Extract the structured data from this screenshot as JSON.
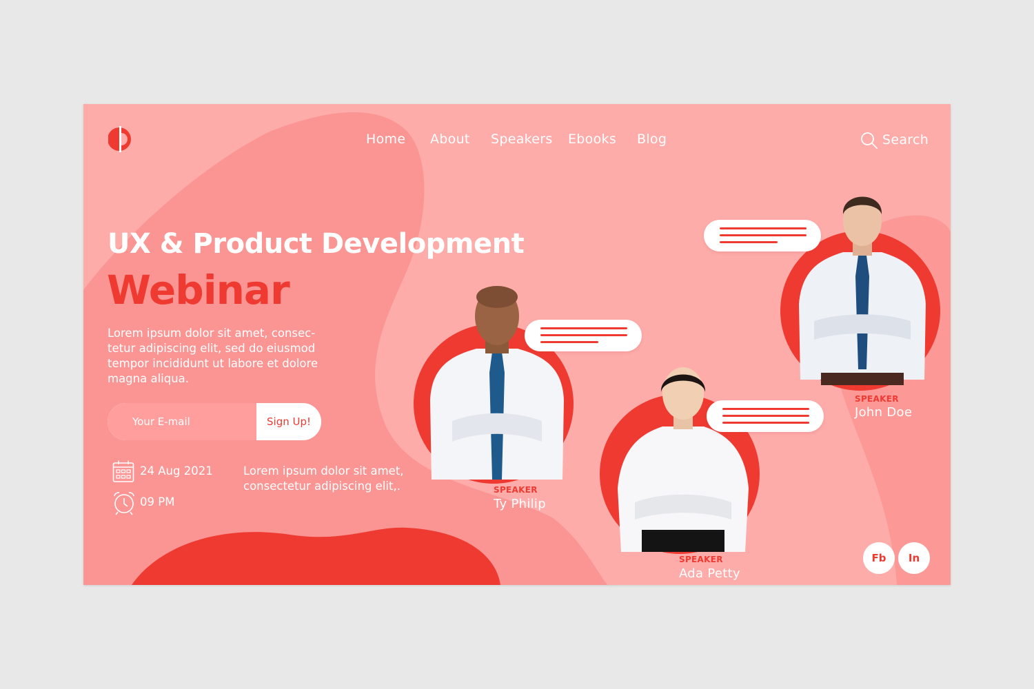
{
  "nav": {
    "items": [
      {
        "label": "Home"
      },
      {
        "label": "About"
      },
      {
        "label": "Speakers"
      },
      {
        "label": "Ebooks"
      },
      {
        "label": "Blog"
      }
    ],
    "search_label": "Search"
  },
  "hero": {
    "title_line1": "UX & Product Development",
    "title_line2": "Webinar",
    "description": "Lorem ipsum dolor sit amet, consec-tetur adipiscing elit, sed do eiusmod tempor incididunt ut labore et dolore magna aliqua.",
    "email_placeholder": "Your E-mail",
    "signup_label": "Sign Up!"
  },
  "event": {
    "date": "24 Aug 2021",
    "time": "09 PM",
    "description": "Lorem ipsum dolor sit amet, consectetur adipiscing elit,."
  },
  "speakers": [
    {
      "role": "SPEAKER",
      "name": "Ty Philip"
    },
    {
      "role": "SPEAKER",
      "name": "Ada Petty"
    },
    {
      "role": "SPEAKER",
      "name": "John Doe"
    }
  ],
  "social": {
    "facebook_label": "Fb",
    "linkedin_label": "In"
  },
  "colors": {
    "background": "#fdacaa",
    "accent": "#ef3a31",
    "blob": "#fb9593",
    "page": "#e8e8e8"
  },
  "icons": [
    "logo-mark",
    "search-icon",
    "calendar-icon",
    "alarm-clock-icon"
  ]
}
